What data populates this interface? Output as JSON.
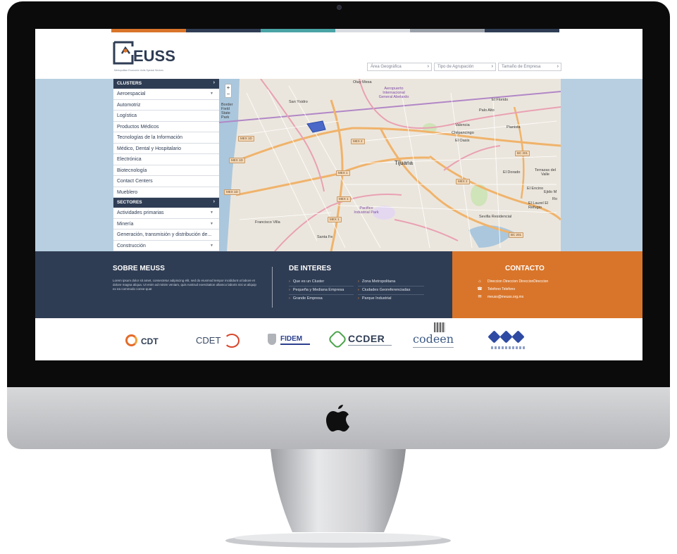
{
  "brand": {
    "logo_text": "EUSS",
    "logo_letter": "M",
    "tagline": "Metropolitan Economic Units Special Sectors"
  },
  "colors": {
    "navy": "#2f3d54",
    "orange": "#d9752a",
    "teal": "#4aa3a5",
    "map_water": "#b7cfe1",
    "strip": [
      "#d9752a",
      "#2f3d54",
      "#4aa3a5",
      "#d9dde2",
      "#9aa0a8",
      "#2f3d54"
    ]
  },
  "filters": [
    {
      "label": "Área Geográfica"
    },
    {
      "label": "Tipo de Agrupación"
    },
    {
      "label": "Tamaño de Empresa"
    }
  ],
  "menu": {
    "clusters_heading": "CLUSTERS",
    "clusters": [
      {
        "label": "Aeroespacial",
        "has_dropdown": true
      },
      {
        "label": "Automotriz"
      },
      {
        "label": "Logística"
      },
      {
        "label": "Productos Médicos"
      },
      {
        "label": "Tecnologías de la Información"
      },
      {
        "label": "Médico, Dental y Hospitalario"
      },
      {
        "label": "Electrónica"
      },
      {
        "label": "Biotecnología"
      },
      {
        "label": "Contact Centers"
      },
      {
        "label": "Mueblero"
      }
    ],
    "sectors_heading": "SECTORES",
    "sectors": [
      {
        "label": "Actividades primarias",
        "has_dropdown": true
      },
      {
        "label": "Minería",
        "has_dropdown": true
      },
      {
        "label": "Generación, transmisión y distribución de..."
      },
      {
        "label": "Construcción",
        "has_dropdown": true
      }
    ]
  },
  "map": {
    "zoom_in": "+",
    "zoom_out": "−",
    "labels": {
      "tijuana": "Tijuana",
      "otay_mesa": "Otay Mesa",
      "aeropuerto": "Aeropuerto Internacional General Abelardo",
      "san_ysidro": "San Ysidro",
      "border_field": "Border Field State Park",
      "el_florido": "El Florido",
      "valencia": "Valencia",
      "chilpancingo": "Chilpancingo",
      "el_oasis": "El Oasis",
      "el_dorado": "El Dorado",
      "terrazas": "Terrazas del Valle",
      "el_encino": "El Encino",
      "ejido": "Ejido M",
      "el_laurel": "El Laurel El Refugio",
      "sevilla": "Sevilla Residencial",
      "francisco_villa": "Francisco Villa",
      "pacifico": "Pacifico Industrial Park",
      "santa_fe": "Santa Fe",
      "palo_alto": "Palo Alto",
      "pianista": "Pianista",
      "roj": "Ro"
    },
    "shields": [
      "MEX 1D",
      "MEX 1D",
      "MEX 2",
      "MEX 1",
      "MEX 2",
      "MEX 1D",
      "MEX 1",
      "MEX 1",
      "BC 201",
      "BC 201"
    ]
  },
  "about": {
    "title": "SOBRE MEUSS",
    "body": "Lorem ipsum dolor sit amet, consectetur adipiscing elit, sed do eiusmod tempor incididunt ut labore et dolore magna aliqua. Ut enim ad minim veniam, quis nostrud exercitation ullamco laboris nisi ut aliquip ex ea commodo conse-quat"
  },
  "interest": {
    "title": "DE INTERES",
    "links_left": [
      "Que es un Cluster",
      "Pequeña y Mediana Empresa",
      "Grande Empresa"
    ],
    "links_right": [
      "Zona Metropolitana",
      "Ciudades Georeferenciadas",
      "Parque Industrial"
    ]
  },
  "contact": {
    "title": "CONTACTO",
    "address": "Direccion Direccion DireccionDireccion",
    "phone": "Telefono Telefono",
    "email": "meuss@meuss.org.mx"
  },
  "partners": [
    {
      "name": "CDT",
      "icon": "cdt-ring-icon"
    },
    {
      "name": "CDET",
      "icon": "cdet-swirl-icon"
    },
    {
      "name": "FIDEM",
      "icon": "fidem-crest-icon"
    },
    {
      "name": "CCDER",
      "icon": "ccder-hex-icon"
    },
    {
      "name": "codeen",
      "icon": "codeen-cube-icon"
    },
    {
      "name": "COC",
      "icon": "coc-diamonds-icon"
    }
  ]
}
